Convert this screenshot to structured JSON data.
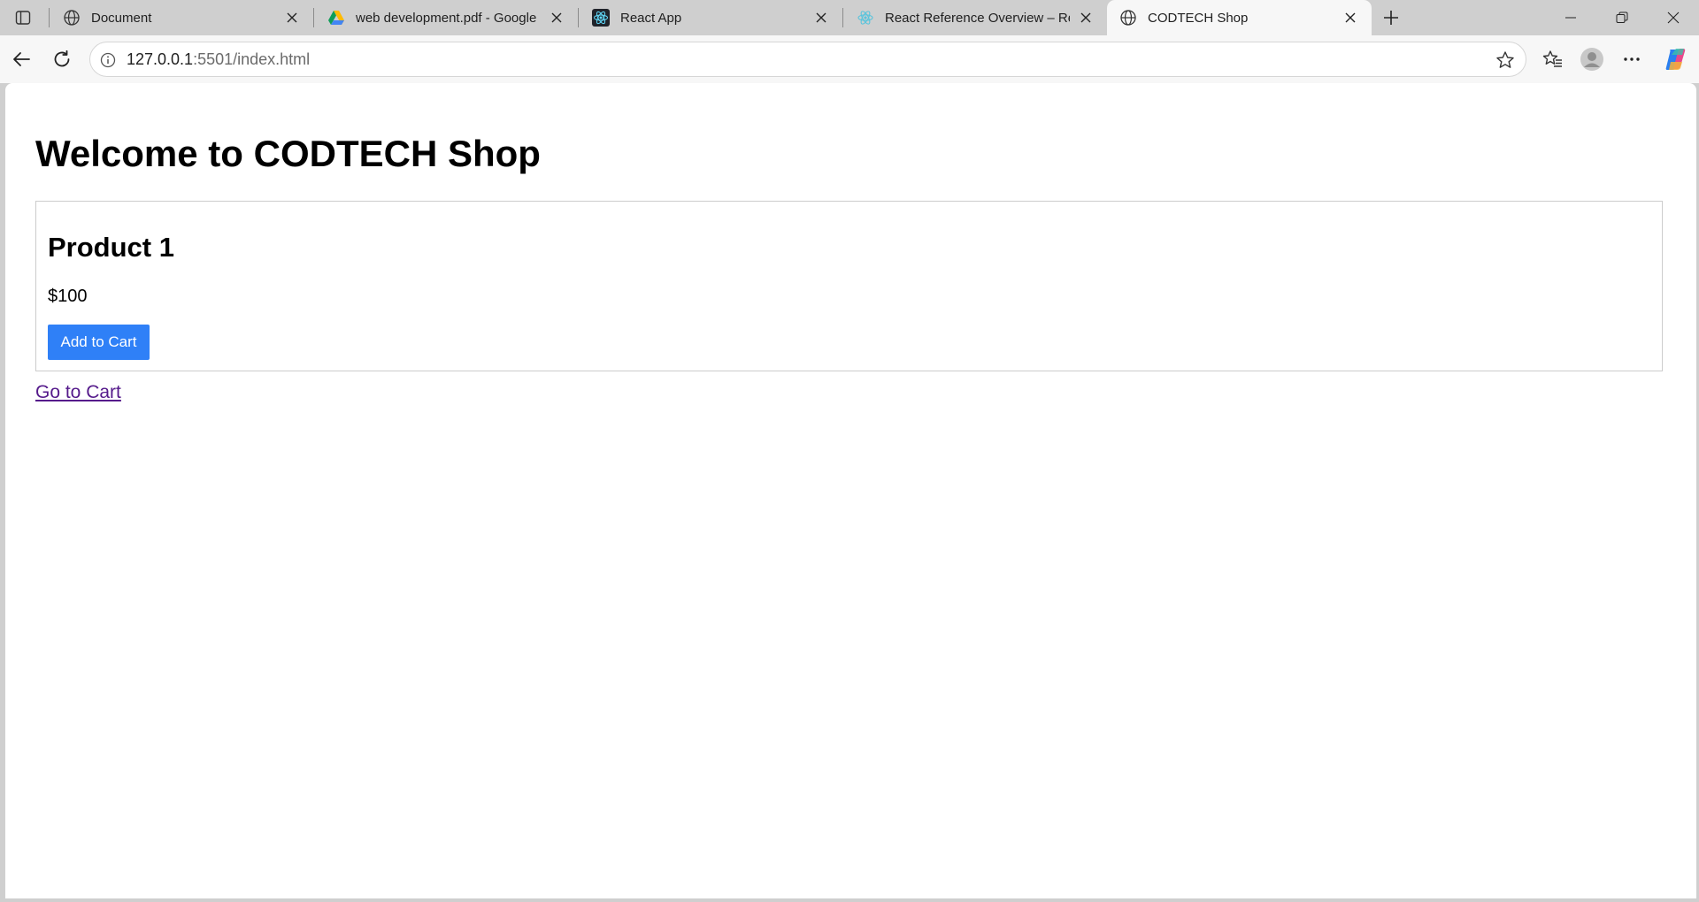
{
  "browser": {
    "tabs": [
      {
        "title": "Document",
        "icon": "globe-icon",
        "active": false
      },
      {
        "title": "web development.pdf - Google Drive",
        "icon": "google-drive-icon",
        "active": false
      },
      {
        "title": "React App",
        "icon": "react-icon",
        "active": false
      },
      {
        "title": "React Reference Overview – React",
        "icon": "react-icon",
        "active": false
      },
      {
        "title": "CODTECH Shop",
        "icon": "globe-icon",
        "active": true
      }
    ],
    "address": {
      "host": "127.0.0.1",
      "rest": ":5501/index.html"
    },
    "colors": {
      "tabstrip_bg": "#cfcfcf",
      "toolbar_bg": "#f7f7f7",
      "button_blue": "#2f80f7",
      "visited_link": "#551a8b"
    }
  },
  "page": {
    "title": "Welcome to CODTECH Shop",
    "product": {
      "name": "Product 1",
      "price": "$100",
      "button_label": "Add to Cart"
    },
    "cart_link": "Go to Cart"
  }
}
